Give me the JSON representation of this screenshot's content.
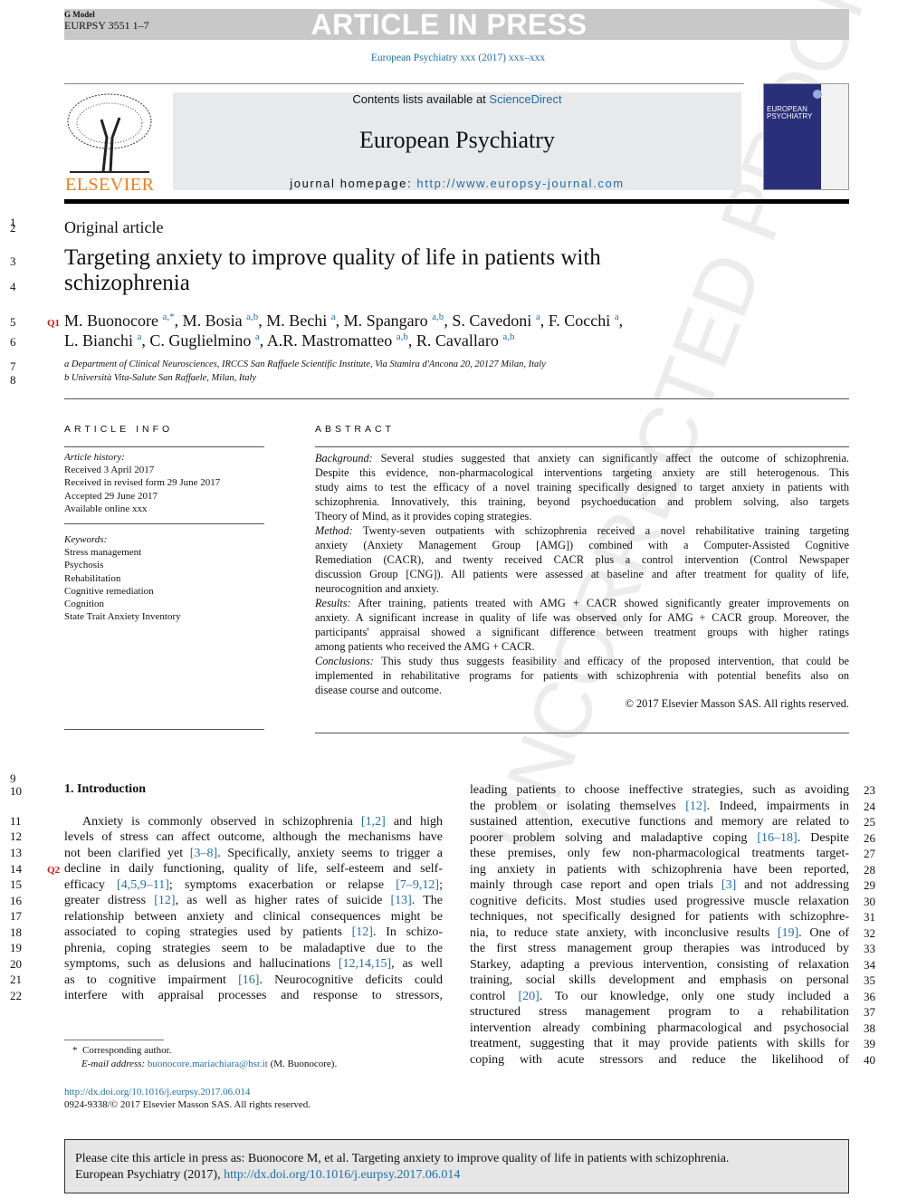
{
  "header": {
    "gmodel": "G Model",
    "code": "EURPSY 3551 1–7",
    "banner": "ARTICLE IN PRESS",
    "journal_ref": "European Psychiatry xxx (2017) xxx–xxx",
    "contents_prefix": "Contents lists available at ",
    "sciencedirect": "ScienceDirect",
    "journal_title": "European Psychiatry",
    "homepage_prefix": "journal homepage: ",
    "homepage_url": "http://www.europsy-journal.com",
    "publisher": "ELSEVIER",
    "cover_title": "EUROPEAN PSYCHIATRY"
  },
  "watermark": "UNCORRECTED PROOF",
  "article": {
    "type": "Original article",
    "title_lines": [
      "Targeting anxiety to improve quality of life in patients with",
      "schizophrenia"
    ],
    "authors_line1": [
      [
        "M. Buonocore",
        "a,*"
      ],
      [
        "M. Bosia",
        "a,b"
      ],
      [
        "M. Bechi",
        "a"
      ],
      [
        "M. Spangaro",
        "a,b"
      ],
      [
        "S. Cavedoni",
        "a"
      ],
      [
        "F. Cocchi",
        "a"
      ]
    ],
    "authors_line2": [
      [
        "L. Bianchi",
        "a"
      ],
      [
        "C. Guglielmino",
        "a"
      ],
      [
        "A.R. Mastromatteo",
        "a,b"
      ],
      [
        "R. Cavallaro",
        "a,b"
      ]
    ],
    "affiliations": [
      "a Department of Clinical Neurosciences, IRCCS San Raffaele Scientific Institute, Via Stamira d'Ancona 20, 20127 Milan, Italy",
      "b Università Vita-Salute San Raffaele, Milan, Italy"
    ],
    "queries": [
      "Q1",
      "Q2"
    ]
  },
  "article_info": {
    "heading": "ARTICLE INFO",
    "history_label": "Article history:",
    "history": [
      "Received 3 April 2017",
      "Received in revised form 29 June 2017",
      "Accepted 29 June 2017",
      "Available online xxx"
    ],
    "keywords_label": "Keywords:",
    "keywords": [
      "Stress management",
      "Psychosis",
      "Rehabilitation",
      "Cognitive remediation",
      "Cognition",
      "State Trait Anxiety Inventory"
    ]
  },
  "abstract": {
    "heading": "ABSTRACT",
    "lines": [
      [
        "Background:",
        "Several studies suggested that anxiety can significantly affect the outcome of schizophrenia."
      ],
      [
        "",
        "Despite this evidence, non-pharmacological interventions targeting anxiety are still heterogenous. This"
      ],
      [
        "",
        "study aims to test the efficacy of a novel training specifically designed to target anxiety in patients with"
      ],
      [
        "",
        "schizophrenia. Innovatively, this training, beyond psychoeducation and problem solving, also targets"
      ],
      [
        "",
        "Theory of Mind, as it provides coping strategies."
      ],
      [
        "Method:",
        "Twenty-seven outpatients with schizophrenia received a novel rehabilitative training targeting"
      ],
      [
        "",
        "anxiety (Anxiety Management Group [AMG]) combined with a Computer-Assisted Cognitive"
      ],
      [
        "",
        "Remediation (CACR), and twenty received CACR plus a control intervention (Control Newspaper"
      ],
      [
        "",
        "discussion Group [CNG]). All patients were assessed at baseline and after treatment for quality of life,"
      ],
      [
        "",
        "neurocognition and anxiety."
      ],
      [
        "Results:",
        "After training, patients treated with AMG + CACR showed significantly greater improvements on"
      ],
      [
        "",
        "anxiety. A significant increase in quality of life was observed only for AMG + CACR group. Moreover, the"
      ],
      [
        "",
        "participants' appraisal showed a significant difference between treatment groups with higher ratings"
      ],
      [
        "",
        "among patients who received the AMG + CACR."
      ],
      [
        "Conclusions:",
        "This study thus suggests feasibility and efficacy of the proposed intervention, that could be"
      ],
      [
        "",
        "implemented in rehabilitative programs for patients with schizophrenia with potential benefits also on"
      ],
      [
        "",
        "disease course and outcome."
      ]
    ],
    "copyright": "© 2017 Elsevier Masson SAS. All rights reserved."
  },
  "intro": {
    "heading": "1. Introduction",
    "left_lines": [
      "Anxiety is commonly observed in schizophrenia [1,2] and high",
      "levels of stress can affect outcome, although the mechanisms have",
      "not been clarified yet [3–8]. Specifically, anxiety seems to trigger a",
      "decline in daily functioning, quality of life, self-esteem and self-",
      "efficacy [4,5,9–11]; symptoms exacerbation or relapse [7–9,12];",
      "greater distress [12], as well as higher rates of suicide [13]. The",
      "relationship between anxiety and clinical consequences might be",
      "associated to coping strategies used by patients [12]. In schizo-",
      "phrenia, coping strategies seem to be maladaptive due to the",
      "symptoms, such as delusions and hallucinations [12,14,15], as well",
      "as to cognitive impairment [16]. Neurocognitive deficits could",
      "interfere with appraisal processes and response to stressors,"
    ],
    "right_lines": [
      "leading patients to choose ineffective strategies, such as avoiding",
      "the problem or isolating themselves [12]. Indeed, impairments in",
      "sustained attention, executive functions and memory are related to",
      "poorer problem solving and maladaptive coping [16–18]. Despite",
      "these premises, only few non-pharmacological treatments target-",
      "ing anxiety in patients with schizophrenia have been reported,",
      "mainly through case report and open trials [3] and not addressing",
      "cognitive deficits. Most studies used progressive muscle relaxation",
      "techniques, not specifically designed for patients with schizophre-",
      "nia, to reduce state anxiety, with inconclusive results [19]. One of",
      "the first stress management group therapies was introduced by",
      "Starkey, adapting a previous intervention, consisting of relaxation",
      "training, social skills development and emphasis on personal",
      "control [20]. To our knowledge, only one study included a",
      "structured stress management program to a rehabilitation",
      "intervention already combining pharmacological and psychosocial",
      "treatment, suggesting that it may provide patients with skills for",
      "coping with acute stressors and reduce the likelihood of"
    ]
  },
  "footnote": {
    "mark": "*",
    "corresponding": "Corresponding author.",
    "email_label": "E-mail address: ",
    "email": "buonocore.mariachiara@hsr.it",
    "email_suffix": " (M. Buonocore)."
  },
  "doi": {
    "url": "http://dx.doi.org/10.1016/j.eurpsy.2017.06.014",
    "issn": "0924-9338/© 2017 Elsevier Masson SAS. All rights reserved."
  },
  "citation": {
    "text": "Please cite this article in press as: Buonocore M, et al. Targeting anxiety to improve quality of life in patients with schizophrenia.",
    "text2": "European Psychiatry (2017), ",
    "url": "http://dx.doi.org/10.1016/j.eurpsy.2017.06.014"
  },
  "line_numbers": {
    "left": [
      "1",
      "2",
      "3",
      "4",
      "5",
      "6",
      "7",
      "8",
      "9",
      "10",
      "11",
      "12",
      "13",
      "14",
      "15",
      "16",
      "17",
      "18",
      "19",
      "20",
      "21",
      "22"
    ],
    "right": [
      "23",
      "24",
      "25",
      "26",
      "27",
      "28",
      "29",
      "30",
      "31",
      "32",
      "33",
      "34",
      "35",
      "36",
      "37",
      "38",
      "39",
      "40"
    ]
  },
  "colors": {
    "link": "#1f6fa8",
    "publisher": "#f07d1a",
    "query": "#e01010",
    "banner_bg": "#c8c8c8"
  }
}
